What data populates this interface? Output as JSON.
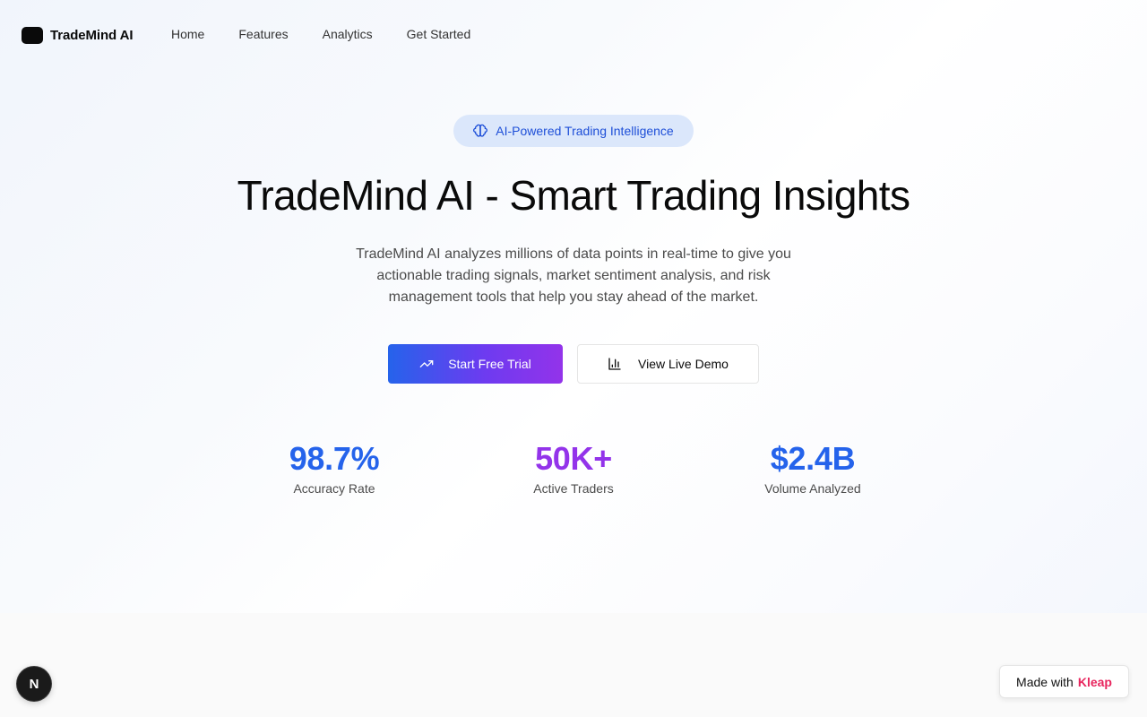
{
  "nav": {
    "logo_text": "TradeMind AI",
    "links": [
      "Home",
      "Features",
      "Analytics",
      "Get Started"
    ]
  },
  "hero": {
    "badge": "AI-Powered Trading Intelligence",
    "badge_icon": "brain-icon",
    "title": "TradeMind AI - Smart Trading Insights",
    "subtitle": "TradeMind AI analyzes millions of data points in real-time to give you actionable trading signals, market sentiment analysis, and risk management tools that help you stay ahead of the market.",
    "primary_button": {
      "label": "Start Free Trial",
      "icon": "trending-up-icon"
    },
    "secondary_button": {
      "label": "View Live Demo",
      "icon": "bar-chart-icon"
    }
  },
  "stats": [
    {
      "value": "98.7%",
      "label": "Accuracy Rate",
      "color": "#2563eb"
    },
    {
      "value": "50K+",
      "label": "Active Traders",
      "color": "#9333ea"
    },
    {
      "value": "$2.4B",
      "label": "Volume Analyzed",
      "color": "#2563eb"
    }
  ],
  "floating": {
    "n_badge": "N",
    "made_with_prefix": "Made with",
    "made_with_brand": "Kleap"
  },
  "colors": {
    "accent_blue": "#2563eb",
    "accent_purple": "#9333ea",
    "brand_pink": "#e8265e"
  }
}
